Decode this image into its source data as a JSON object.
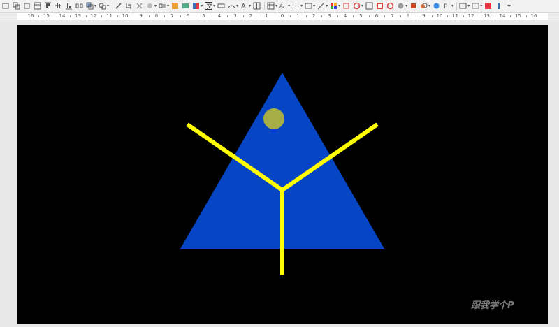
{
  "toolbar": {
    "icons": [
      "new-slide-icon",
      "duplicate-slide-icon",
      "delete-slide-icon",
      "slide-layout-icon",
      "align-top-icon",
      "align-center-icon",
      "align-bottom-icon",
      "distribute-icon",
      "arrange-icon",
      "group-icon",
      "shadow-icon",
      "crop-icon",
      "filter-icon",
      "points-icon",
      "flip-icon",
      "rotate-icon",
      "image-icon",
      "chart-icon",
      "text-icon",
      "fontwork-icon",
      "table-icon",
      "special-char-icon",
      "hyperlink-icon",
      "shapes-icon",
      "lines-icon",
      "curves-icon",
      "connector-icon",
      "basic-shapes-icon",
      "symbol-shapes-icon",
      "block-arrows-icon",
      "flowchart-icon",
      "callouts-icon",
      "stars-icon",
      "3d-objects-icon",
      "glue-points-icon",
      "transition-icon",
      "animation-icon",
      "media-icon",
      "more-icon"
    ]
  },
  "ruler": {
    "labels": [
      "16",
      "15",
      "14",
      "13",
      "12",
      "11",
      "10",
      "9",
      "8",
      "7",
      "6",
      "5",
      "4",
      "3",
      "2",
      "1",
      "0",
      "1",
      "2",
      "3",
      "4",
      "5",
      "6",
      "7",
      "8",
      "9",
      "10",
      "11",
      "12",
      "13",
      "14",
      "15",
      "16"
    ]
  },
  "slide": {
    "background": "#000000",
    "triangle_color": "#0645c4",
    "circle_color": "#a6ad46",
    "lines_color": "#ffff00"
  },
  "watermark": "跟我学个P"
}
